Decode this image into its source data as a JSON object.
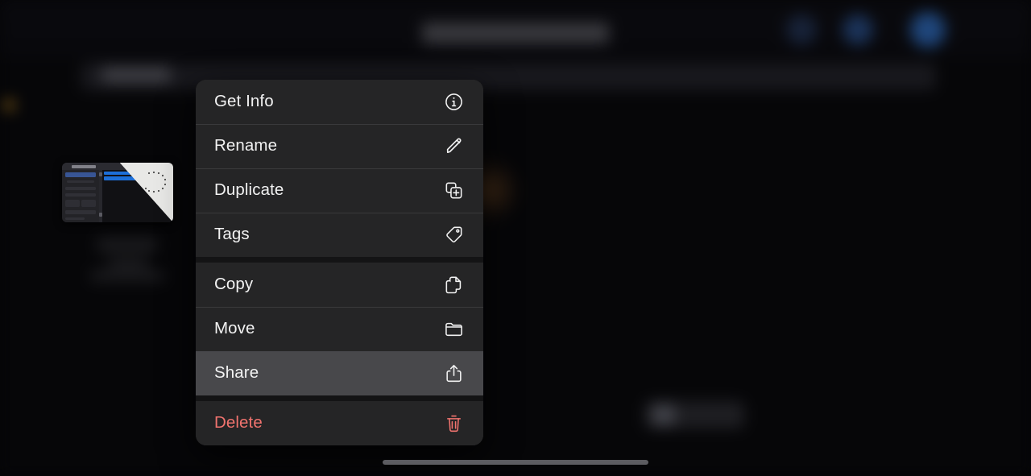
{
  "app": {
    "platform": "ipados-files",
    "background_color": "#050507",
    "accent_color": "#1d6fd8",
    "destructive_color": "#f0736e",
    "menu_background": "#252526",
    "menu_highlight": "#48484b"
  },
  "navbar": {
    "title": "",
    "icons": [
      {
        "name": "nav-action-1"
      },
      {
        "name": "nav-action-2"
      },
      {
        "name": "nav-action-3"
      }
    ]
  },
  "search": {
    "value": "",
    "placeholder": ""
  },
  "file": {
    "name": "",
    "subtitle": "",
    "detail": ""
  },
  "context_menu": {
    "groups": [
      {
        "items": [
          {
            "label": "Get Info",
            "icon": "info-circle-icon",
            "name": "menu-item-get-info",
            "highlighted": false,
            "destructive": false
          },
          {
            "label": "Rename",
            "icon": "pencil-icon",
            "name": "menu-item-rename",
            "highlighted": false,
            "destructive": false
          },
          {
            "label": "Duplicate",
            "icon": "duplicate-icon",
            "name": "menu-item-duplicate",
            "highlighted": false,
            "destructive": false
          },
          {
            "label": "Tags",
            "icon": "tag-icon",
            "name": "menu-item-tags",
            "highlighted": false,
            "destructive": false
          }
        ]
      },
      {
        "items": [
          {
            "label": "Copy",
            "icon": "copy-icon",
            "name": "menu-item-copy",
            "highlighted": false,
            "destructive": false
          },
          {
            "label": "Move",
            "icon": "folder-icon",
            "name": "menu-item-move",
            "highlighted": false,
            "destructive": false
          },
          {
            "label": "Share",
            "icon": "share-icon",
            "name": "menu-item-share",
            "highlighted": true,
            "destructive": false
          }
        ]
      },
      {
        "items": [
          {
            "label": "Delete",
            "icon": "trash-icon",
            "name": "menu-item-delete",
            "highlighted": false,
            "destructive": true
          }
        ]
      }
    ]
  },
  "home_indicator": {
    "visible": true
  }
}
